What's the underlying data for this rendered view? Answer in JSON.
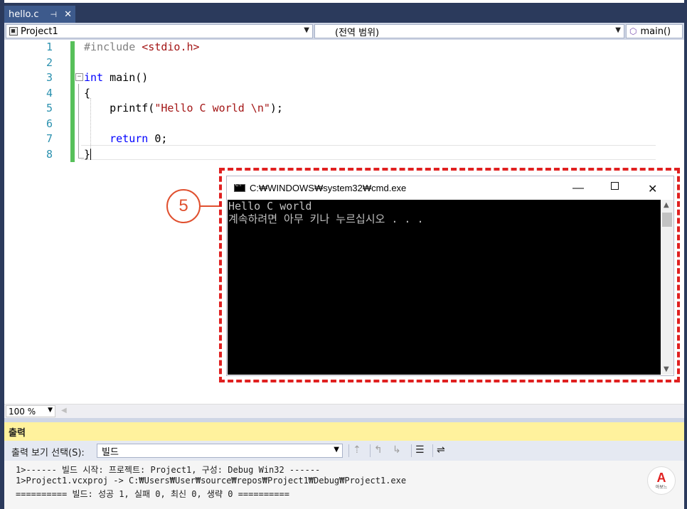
{
  "tab": {
    "filename": "hello.c",
    "pin_glyph": "⊣",
    "close_glyph": "✕"
  },
  "nav": {
    "project": "Project1",
    "scope": "(전역 범위)",
    "member": "main()"
  },
  "code_lines": [
    {
      "num": "1",
      "html": "<span class=\"kw-pre\">#include</span> <span class=\"str\">&lt;stdio.h&gt;</span>"
    },
    {
      "num": "2",
      "html": ""
    },
    {
      "num": "3",
      "html": "<span class=\"kw\">int</span> main()"
    },
    {
      "num": "4",
      "html": "{"
    },
    {
      "num": "5",
      "html": "    printf(<span class=\"str\">\"Hello C world \\n\"</span>);"
    },
    {
      "num": "6",
      "html": ""
    },
    {
      "num": "7",
      "html": "    <span class=\"kw\">return</span> 0;"
    },
    {
      "num": "8",
      "html": "}"
    }
  ],
  "callout": {
    "number": "5"
  },
  "console": {
    "title": "C:₩WINDOWS₩system32₩cmd.exe",
    "lines": [
      "Hello C world",
      "계속하려면 아무 키나 누르십시오 . . ."
    ]
  },
  "zoom": {
    "level": "100 %"
  },
  "output": {
    "title": "출력",
    "show_label": "출력 보기 선택(S):",
    "source": "빌드",
    "lines": [
      "1>------ 빌드 시작: 프로젝트: Project1, 구성: Debug Win32 ------",
      "1>Project1.vcxproj -> C:₩Users₩User₩source₩repos₩Project1₩Debug₩Project1.exe",
      "========== 빌드: 성공 1, 실패 0, 최신 0, 생략 0 =========="
    ]
  },
  "logo": {
    "letter": "A",
    "text": "아보느"
  },
  "colors": {
    "frame": "#2b3a5c",
    "highlight": "#e02020",
    "output_title_bg": "#fff29d",
    "margin_green": "#57c05a"
  }
}
